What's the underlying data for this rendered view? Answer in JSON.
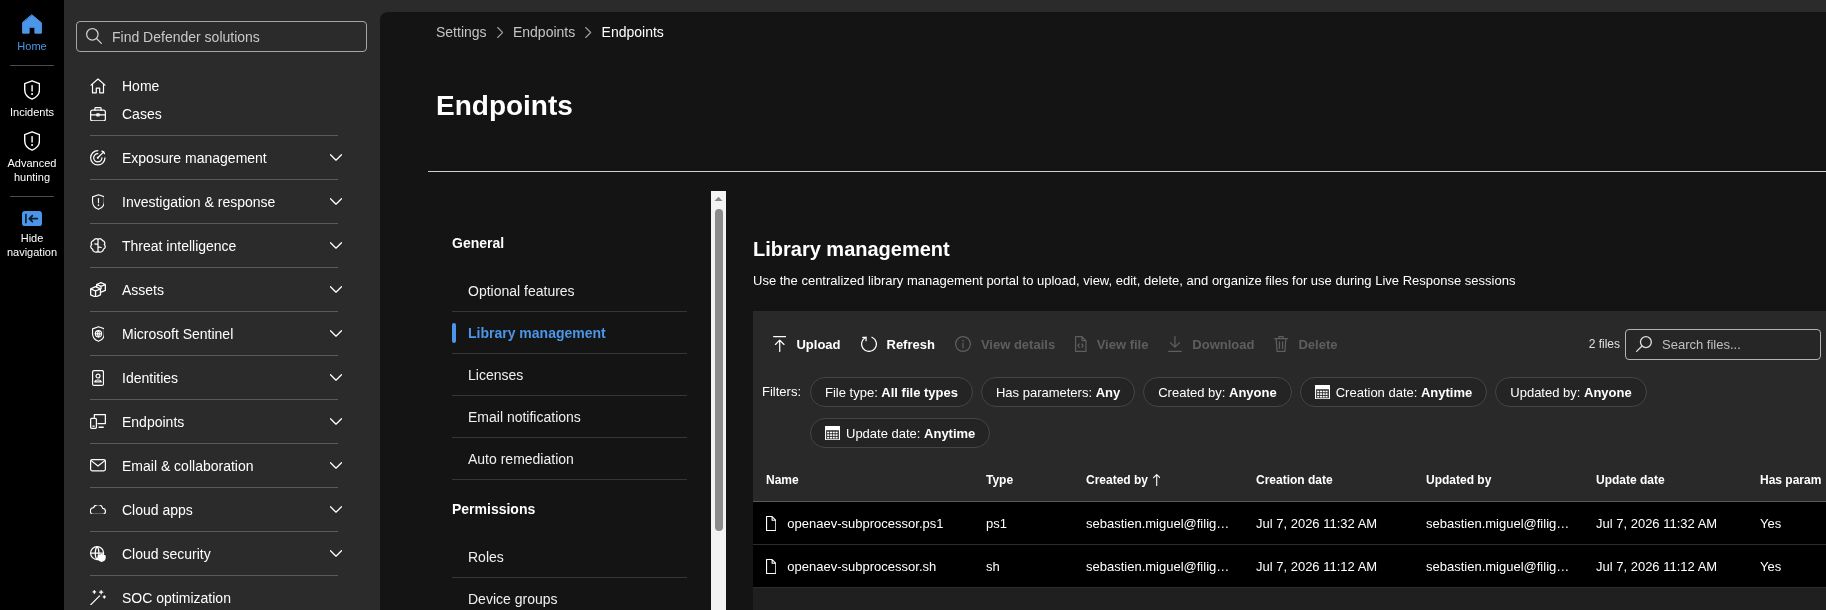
{
  "rail": {
    "items": [
      {
        "label": "Home",
        "selected": true
      },
      {
        "label": "Incidents",
        "selected": false
      },
      {
        "label": "Advanced hunting",
        "selected": false
      }
    ],
    "hide_navigation": {
      "label": "Hide navigation"
    }
  },
  "nav": {
    "search": {
      "placeholder": "Find Defender solutions"
    },
    "items": [
      {
        "label": "Home",
        "kind": "link"
      },
      {
        "label": "Cases",
        "kind": "link"
      },
      {
        "label": "Exposure management",
        "kind": "group",
        "expanded": false
      },
      {
        "label": "Investigation & response",
        "kind": "group",
        "expanded": false
      },
      {
        "label": "Threat intelligence",
        "kind": "group",
        "expanded": false
      },
      {
        "label": "Assets",
        "kind": "group",
        "expanded": false
      },
      {
        "label": "Microsoft Sentinel",
        "kind": "group",
        "expanded": false
      },
      {
        "label": "Identities",
        "kind": "group",
        "expanded": false
      },
      {
        "label": "Endpoints",
        "kind": "group",
        "expanded": false
      },
      {
        "label": "Email & collaboration",
        "kind": "group",
        "expanded": false
      },
      {
        "label": "Cloud apps",
        "kind": "group",
        "expanded": false
      },
      {
        "label": "Cloud security",
        "kind": "group",
        "expanded": false
      },
      {
        "label": "SOC optimization",
        "kind": "link"
      }
    ]
  },
  "breadcrumb": [
    {
      "label": "Settings",
      "current": false
    },
    {
      "label": "Endpoints",
      "current": false
    },
    {
      "label": "Endpoints",
      "current": true
    }
  ],
  "page_title": "Endpoints",
  "settings_nav": {
    "sections": [
      {
        "title": "General",
        "items": [
          {
            "label": "Optional features",
            "selected": false
          },
          {
            "label": "Library management",
            "selected": true
          },
          {
            "label": "Licenses",
            "selected": false
          },
          {
            "label": "Email notifications",
            "selected": false
          },
          {
            "label": "Auto remediation",
            "selected": false
          }
        ]
      },
      {
        "title": "Permissions",
        "items": [
          {
            "label": "Roles",
            "selected": false
          },
          {
            "label": "Device groups",
            "selected": false
          }
        ]
      }
    ]
  },
  "library": {
    "title": "Library management",
    "description": "Use the centralized library management portal to upload, view, edit, delete, and organize files for use during Live Response sessions",
    "toolbar": [
      {
        "label": "Upload",
        "disabled": false
      },
      {
        "label": "Refresh",
        "disabled": false
      },
      {
        "label": "View details",
        "disabled": true
      },
      {
        "label": "View file",
        "disabled": true
      },
      {
        "label": "Download",
        "disabled": true
      },
      {
        "label": "Delete",
        "disabled": true
      }
    ],
    "file_count": "2 files",
    "search": {
      "placeholder": "Search files..."
    },
    "filters": {
      "label": "Filters:",
      "chips": [
        {
          "text": "File type: **All file types**",
          "kind": "plain"
        },
        {
          "text": "Has parameters: **Any**",
          "kind": "plain"
        },
        {
          "text": "Created by: **Anyone**",
          "kind": "plain"
        },
        {
          "text": "Creation date: **Anytime**",
          "kind": "date"
        },
        {
          "text": "Updated by: **Anyone**",
          "kind": "plain"
        },
        {
          "text": "Update date: **Anytime**",
          "kind": "date"
        }
      ]
    },
    "table": {
      "columns": [
        {
          "label": "Name",
          "sorted": false
        },
        {
          "label": "Type",
          "sorted": false
        },
        {
          "label": "Created by",
          "sorted": true
        },
        {
          "label": "Creation date",
          "sorted": false
        },
        {
          "label": "Updated by",
          "sorted": false
        },
        {
          "label": "Update date",
          "sorted": false
        },
        {
          "label": "Has param",
          "sorted": false
        }
      ],
      "rows": [
        {
          "cells": [
            "openaev-subprocessor.ps1",
            "ps1",
            "sebastien.miguel@filig…",
            "Jul 7, 2026 11:32 AM",
            "sebastien.miguel@filig…",
            "Jul 7, 2026 11:32 AM",
            "Yes"
          ]
        },
        {
          "cells": [
            "openaev-subprocessor.sh",
            "sh",
            "sebastien.miguel@filig…",
            "Jul 7, 2026 11:12 AM",
            "sebastien.miguel@filig…",
            "Jul 7, 2026 11:12 AM",
            "Yes"
          ]
        }
      ]
    }
  }
}
